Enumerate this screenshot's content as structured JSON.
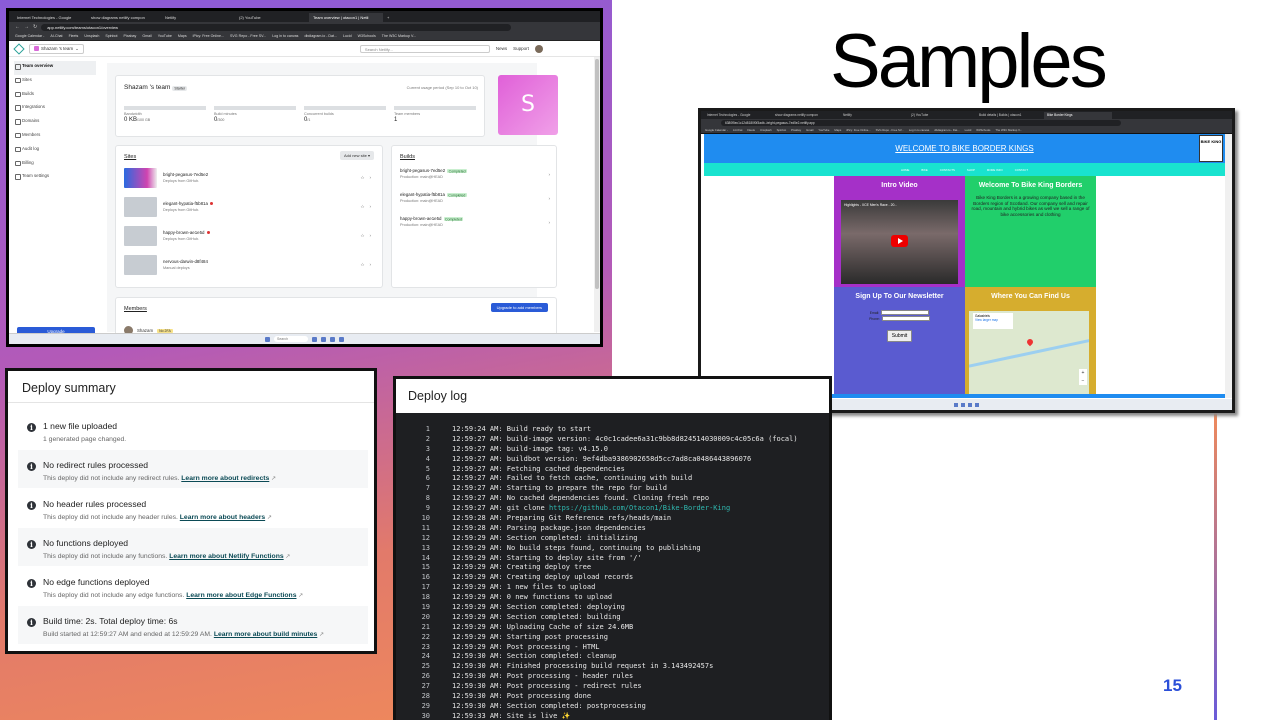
{
  "slide": {
    "title": "Samples",
    "page_number": "15"
  },
  "netlify_shot": {
    "tabs": [
      "Internet Technologies - Google",
      "show diagrams netlify compon",
      "Netlify",
      "(2) YouTube",
      "Team overview | otacon1 | Netli",
      "+"
    ],
    "url": "app.netlify.com/teams/otacon1/overview",
    "bookmarks": [
      "Google Calendar -",
      "AI-Chat",
      "Fleets",
      "Unsplash",
      "Spinbot",
      "Pixabay",
      "Gmail",
      "YouTube",
      "Maps",
      "iPicy: Free Online...",
      "SVG Repo - Free SV...",
      "Log in to canvas",
      "dbdiagram.io - Dat...",
      "Lucid",
      "W3Schools",
      "The W3C Markup V..."
    ],
    "team_select": "Shazam 's team",
    "search_placeholder": "Search Netlify...",
    "news": "News",
    "support": "Support",
    "sidebar": [
      "Team overview",
      "Sites",
      "Builds",
      "Integrations",
      "Domains",
      "Members",
      "Audit log",
      "Billing",
      "Team settings"
    ],
    "upgrade": "Upgrade",
    "team_name": "Shazam 's team",
    "team_badge": "Starter",
    "period": "Current usage period (Sep 10 to Oct 10)",
    "usage": [
      {
        "label": "Bandwidth",
        "value": "0 KB",
        "unit": "/100 GB"
      },
      {
        "label": "Build minutes",
        "value": "0",
        "unit": "/300"
      },
      {
        "label": "Concurrent builds",
        "value": "0",
        "unit": "/1"
      },
      {
        "label": "Team members",
        "value": "1",
        "unit": ""
      }
    ],
    "avatar_letter": "S",
    "sites_title": "Sites",
    "add_site": "Add new site",
    "sites": [
      {
        "name": "bright-pegasus-7ed5e2",
        "sub": "Deploys from GitHub.",
        "error": false
      },
      {
        "name": "elegant-hypatia-f5b81a",
        "sub": "Deploys from GitHub.",
        "error": true
      },
      {
        "name": "happy-brown-ae1e5d",
        "sub": "Deploys from GitHub.",
        "error": true
      },
      {
        "name": "nervous-darwin-d8f484",
        "sub": "Manual deploys",
        "error": false
      }
    ],
    "builds_title": "Builds",
    "builds": [
      {
        "name": "bright-pegasus-7ed5e2",
        "status": "Completed",
        "sub": "Production: main@HEAD"
      },
      {
        "name": "elegant-hypatia-f5b81a",
        "status": "Completed",
        "sub": "Production: main@HEAD"
      },
      {
        "name": "happy-brown-ae1e5d",
        "status": "Completed",
        "sub": "Production: main@HEAD"
      }
    ],
    "members_title": "Members",
    "upgrade_members": "Upgrade to add members",
    "member_name": "Shazam",
    "member_badge": "No 2FA",
    "taskbar_search": "Search"
  },
  "bike_shot": {
    "tabs": [
      "Internet Technologies - Google",
      "show diagrams netlify compon",
      "Netlify",
      "(2) YouTube",
      "Build details | Builds | otacon1",
      "Bike Border Kings"
    ],
    "url": "6380f5ec1c12d8180f0f3adb--bright-pegasus-7ed5e2.netlify.app",
    "bookmarks": [
      "Google Calendar -",
      "AI-Chat",
      "Fleets",
      "Unsplash",
      "Spinbot",
      "Pixabay",
      "Gmail",
      "YouTube",
      "Maps",
      "iPicy: Free Online...",
      "SVG Repo - Free SV...",
      "Log in to canvas",
      "dbdiagram.io - Dat...",
      "Lucid",
      "W3Schools",
      "The W3C Markup V..."
    ],
    "header_title": "WELCOME TO BIKE BORDER KINGS",
    "logo_text": "BIKE KING",
    "nav": [
      "HOME",
      "BIKE",
      "CONTACTS",
      "SHOP",
      "MORE INFO",
      "CONTACT"
    ],
    "intro_title": "Intro Video",
    "video_title": "Highlights - XCE Men's Race - 20...",
    "welcome_title": "Welcome To Bike King Borders",
    "welcome_text": "Bike King Borders is a growing company based in the Borders region of Scotland. Our company sell and repair road, mountain and hybrid bikes as well we sell a range of bike accessories and clothing",
    "newsletter_title": "Sign Up To Our Newsletter",
    "email_label": "Email:",
    "phone_label": "Phone:",
    "submit": "Submit",
    "find_title": "Where You Can Find Us",
    "map_place": "Galashiels",
    "map_link": "View larger map"
  },
  "deploy_summary": {
    "title": "Deploy summary",
    "items": [
      {
        "head": "1 new file uploaded",
        "sub": "1 generated page changed.",
        "link": ""
      },
      {
        "head": "No redirect rules processed",
        "sub": "This deploy did not include any redirect rules.",
        "link": "Learn more about redirects"
      },
      {
        "head": "No header rules processed",
        "sub": "This deploy did not include any header rules.",
        "link": "Learn more about headers"
      },
      {
        "head": "No functions deployed",
        "sub": "This deploy did not include any functions.",
        "link": "Learn more about Netlify Functions"
      },
      {
        "head": "No edge functions deployed",
        "sub": "This deploy did not include any edge functions.",
        "link": "Learn more about Edge Functions"
      },
      {
        "head": "Build time: 2s. Total deploy time: 6s",
        "sub": "Build started at 12:59:27 AM and ended at 12:59:29 AM.",
        "link": "Learn more about build minutes"
      }
    ]
  },
  "deploy_log": {
    "title": "Deploy log",
    "lines": [
      "12:59:24 AM: Build ready to start",
      "12:59:27 AM: build-image version: 4c0c1cadee6a31c9bb8d824514030009c4c05c6a (focal)",
      "12:59:27 AM: build-image tag: v4.15.0",
      "12:59:27 AM: buildbot version: 9ef4dba9386902658d5cc7ad8ca0486443896076",
      "12:59:27 AM: Fetching cached dependencies",
      "12:59:27 AM: Failed to fetch cache, continuing with build",
      "12:59:27 AM: Starting to prepare the repo for build",
      "12:59:27 AM: No cached dependencies found. Cloning fresh repo",
      "12:59:27 AM: git clone ",
      "12:59:28 AM: Preparing Git Reference refs/heads/main",
      "12:59:28 AM: Parsing package.json dependencies",
      "12:59:29 AM: Section completed: initializing",
      "12:59:29 AM: No build steps found, continuing to publishing",
      "12:59:29 AM: Starting to deploy site from '/'",
      "12:59:29 AM: Creating deploy tree",
      "12:59:29 AM: Creating deploy upload records",
      "12:59:29 AM: 1 new files to upload",
      "12:59:29 AM: 0 new functions to upload",
      "12:59:29 AM: Section completed: deploying",
      "12:59:29 AM: Section completed: building",
      "12:59:29 AM: Uploading Cache of size 24.6MB",
      "12:59:29 AM: Starting post processing",
      "12:59:29 AM: Post processing - HTML",
      "12:59:30 AM: Section completed: cleanup",
      "12:59:30 AM: Finished processing build request in 3.143492457s",
      "12:59:30 AM: Post processing - header rules",
      "12:59:30 AM: Post processing - redirect rules",
      "12:59:30 AM: Post processing done",
      "12:59:30 AM: Section completed: postprocessing",
      "12:59:33 AM: Site is live ✨"
    ],
    "git_link": "https://github.com/Otacon1/Bike-Border-King",
    "git_line_index": 8
  }
}
